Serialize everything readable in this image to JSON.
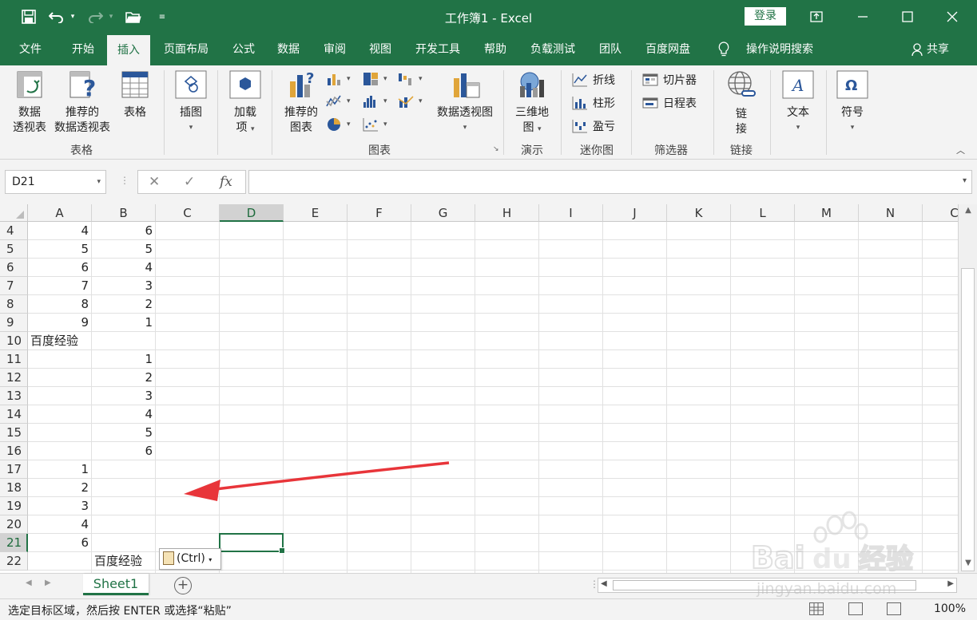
{
  "window": {
    "title": "工作簿1  -  Excel",
    "login": "登录"
  },
  "ribbon_tabs": [
    "文件",
    "开始",
    "插入",
    "页面布局",
    "公式",
    "数据",
    "审阅",
    "视图",
    "开发工具",
    "帮助",
    "负载测试",
    "团队",
    "百度网盘",
    "操作说明搜索"
  ],
  "share": "共享",
  "ribbon": {
    "pivot_line1": "数据",
    "pivot_line2": "透视表",
    "rec_pivot_line1": "推荐的",
    "rec_pivot_line2": "数据透视表",
    "table": "表格",
    "illustrations": "插图",
    "addins_line1": "加载",
    "addins_line2": "项",
    "rec_charts_line1": "推荐的",
    "rec_charts_line2": "图表",
    "pivot_chart": "数据透视图",
    "map3d_line1": "三维地",
    "map3d_line2": "图",
    "spark_line": "折线",
    "spark_column": "柱形",
    "spark_winloss": "盈亏",
    "slicer": "切片器",
    "timeline": "日程表",
    "link_line1": "链",
    "link_line2": "接",
    "text": "文本",
    "symbol": "符号",
    "group_tables": "表格",
    "group_charts": "图表",
    "group_tours": "演示",
    "group_sparklines": "迷你图",
    "group_filters": "筛选器",
    "group_links": "链接"
  },
  "formula_bar": {
    "name_box": "D21",
    "fx": "fx",
    "value": ""
  },
  "columns": [
    "A",
    "B",
    "C",
    "D",
    "E",
    "F",
    "G",
    "H",
    "I",
    "J",
    "K",
    "L",
    "M",
    "N",
    "C"
  ],
  "rows": [
    "4",
    "5",
    "6",
    "7",
    "8",
    "9",
    "10",
    "11",
    "12",
    "13",
    "14",
    "15",
    "16",
    "17",
    "18",
    "19",
    "20",
    "21",
    "22"
  ],
  "cells": {
    "A": [
      "4",
      "5",
      "6",
      "7",
      "8",
      "9",
      "百度经验",
      "",
      "",
      "",
      "",
      "",
      "",
      "1",
      "2",
      "3",
      "4",
      "6",
      ""
    ],
    "B": [
      "6",
      "5",
      "4",
      "3",
      "2",
      "1",
      "",
      "1",
      "2",
      "3",
      "4",
      "5",
      "6",
      "",
      "",
      "",
      "",
      "",
      "百度经验"
    ]
  },
  "paste_options": "(Ctrl)",
  "sheet_tab": "Sheet1",
  "status": {
    "message": "选定目标区域，然后按 ENTER 或选择“粘贴”",
    "zoom": "100%"
  },
  "watermark": {
    "brand": "Baidu经验",
    "url": "jingyan.baidu.com"
  },
  "colors": {
    "excel_green": "#217346",
    "arrow_red": "#e8353a"
  }
}
